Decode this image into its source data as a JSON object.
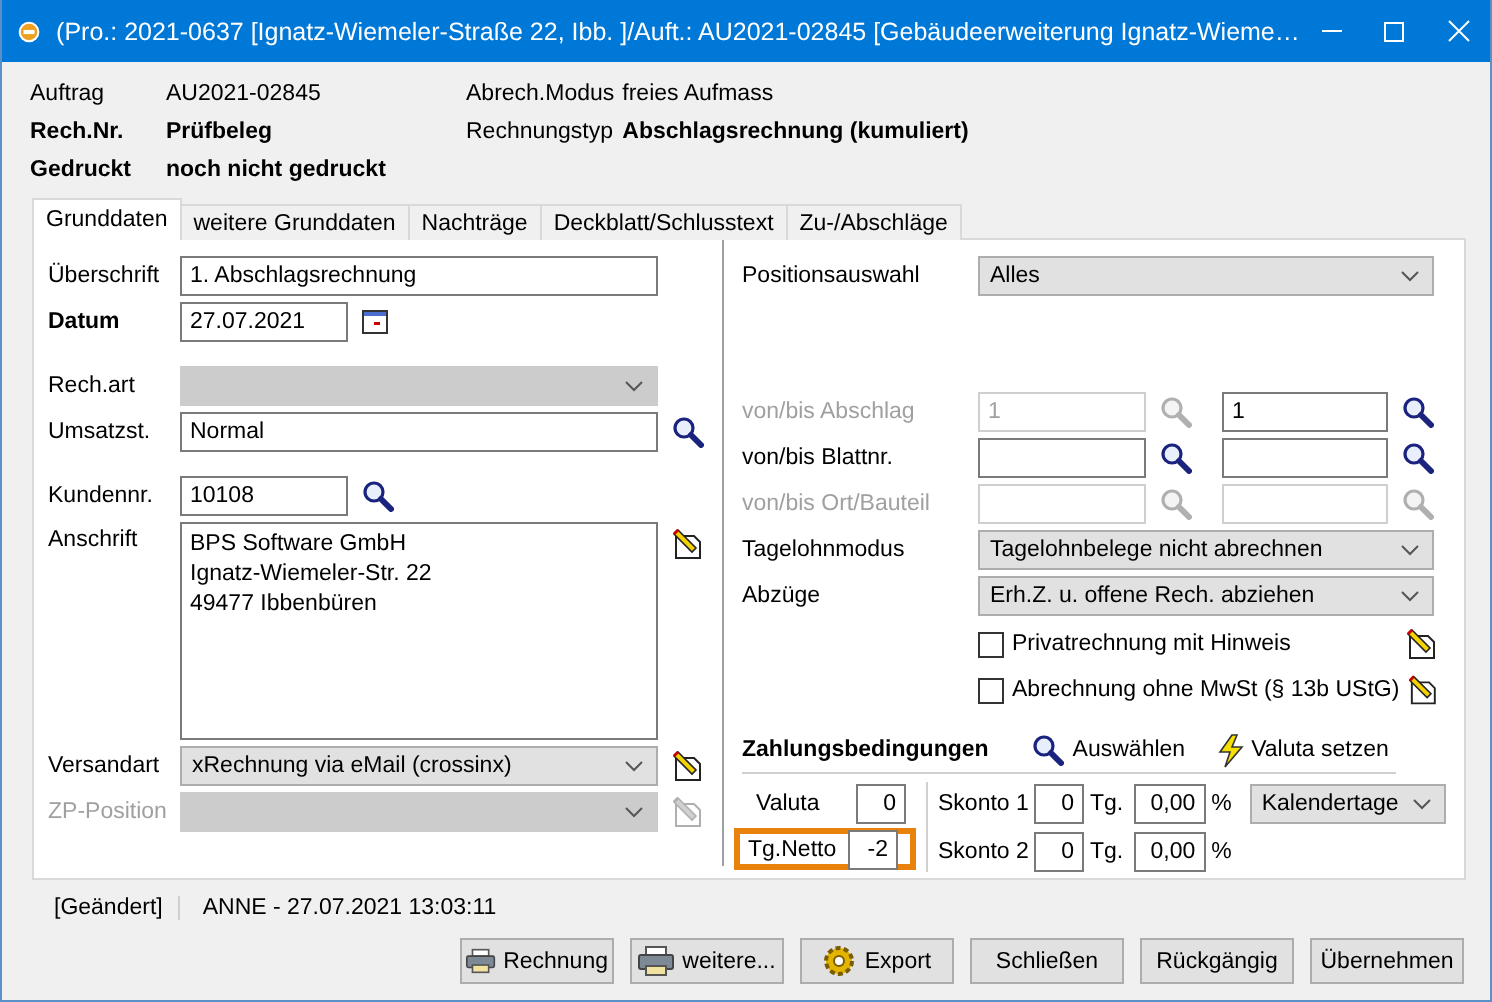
{
  "window": {
    "title": "(Pro.: 2021-0637 [Ignatz-Wiemeler-Straße 22, Ibb. ]/Auft.: AU2021-02845 [Gebäudeerweiterung Ignatz-Wieme…"
  },
  "header": [
    [
      {
        "text": "Auftrag",
        "bold": false
      },
      {
        "text": "AU2021-02845",
        "bold": false
      },
      {
        "text": "Abrech.Modus",
        "bold": false
      },
      {
        "text": "freies Aufmass",
        "bold": false
      }
    ],
    [
      {
        "text": "Rech.Nr.",
        "bold": true
      },
      {
        "text": "Prüfbeleg",
        "bold": true
      },
      {
        "text": "Rechnungstyp",
        "bold": false
      },
      {
        "text": "Abschlagsrechnung (kumuliert)",
        "bold": true
      }
    ],
    [
      {
        "text": "Gedruckt",
        "bold": true
      },
      {
        "text": "noch nicht gedruckt",
        "bold": true
      }
    ]
  ],
  "tabs": [
    {
      "label": "Grunddaten",
      "selected": true
    },
    {
      "label": "weitere Grunddaten",
      "selected": false
    },
    {
      "label": "Nachträge",
      "selected": false
    },
    {
      "label": "Deckblatt/Schlusstext",
      "selected": false
    },
    {
      "label": "Zu-/Abschläge",
      "selected": false
    }
  ],
  "left": {
    "groups": [
      [
        {
          "kind": "text",
          "label": "Überschrift",
          "label_bold": false,
          "label_disabled": false,
          "disabled": false,
          "value": "1. Abschlagsrechnung"
        },
        {
          "kind": "short_text",
          "label": "Datum",
          "label_bold": true,
          "label_disabled": false,
          "disabled": false,
          "value": "27.07.2021",
          "tool": {
            "kind": "calendar"
          }
        }
      ],
      [
        {
          "kind": "select",
          "label": "Rech.art",
          "label_bold": false,
          "label_disabled": false,
          "disabled": true
        },
        {
          "kind": "text",
          "label": "Umsatzst.",
          "label_bold": false,
          "label_disabled": false,
          "disabled": false,
          "value": "Normal",
          "tool": {
            "kind": "search"
          }
        }
      ],
      [
        {
          "kind": "short_text",
          "label": "Kundennr.",
          "label_bold": false,
          "label_disabled": false,
          "disabled": false,
          "value": "10108",
          "tool": {
            "kind": "search"
          }
        },
        {
          "kind": "textarea",
          "label": "Anschrift",
          "label_bold": false,
          "label_disabled": false,
          "disabled": false,
          "value": "BPS Software GmbH\nIgnatz-Wiemeler-Str. 22\n49477 Ibbenbüren",
          "tool": {
            "kind": "edit"
          }
        },
        {
          "kind": "select",
          "label": "Versandart",
          "label_bold": false,
          "label_disabled": false,
          "disabled": false,
          "value": "xRechnung via eMail (crossinx)",
          "tool": {
            "kind": "edit"
          }
        },
        {
          "kind": "select",
          "label": "ZP-Position",
          "label_bold": false,
          "label_disabled": true,
          "disabled": true,
          "tool": {
            "kind": "edit"
          }
        }
      ]
    ]
  },
  "right": {
    "position": {
      "label": "Positionsauswahl",
      "value": "Alles"
    },
    "ranges": [
      {
        "label": "von/bis Abschlag",
        "disabled": true,
        "from": {
          "value": "1",
          "disabled": true
        },
        "to": {
          "value": "1",
          "disabled": false
        }
      },
      {
        "label": "von/bis Blattnr.",
        "disabled": false,
        "from": {
          "disabled": false
        },
        "to": {
          "disabled": false
        }
      },
      {
        "label": "von/bis Ort/Bauteil",
        "disabled": true,
        "from": {
          "disabled": true
        },
        "to": {
          "disabled": true
        }
      }
    ],
    "selects": [
      {
        "label": "Tagelohnmodus",
        "value": "Tagelohnbelege nicht abrechnen"
      },
      {
        "label": "Abzüge",
        "value": "Erh.Z. u. offene Rech. abziehen"
      }
    ],
    "checkboxes": [
      {
        "label": "Privatrechnung mit Hinweis",
        "checked": false
      },
      {
        "label": "Abrechnung ohne MwSt (§ 13b UStG)",
        "checked": false
      }
    ]
  },
  "payment": {
    "title": "Zahlungsbedingungen",
    "links": [
      {
        "label": "Auswählen",
        "kind": "search"
      },
      {
        "label": "Valuta setzen",
        "kind": "lightning"
      }
    ],
    "terms": [
      {
        "label": "Valuta",
        "value": "0",
        "highlighted": false
      },
      {
        "label": "Tg.Netto",
        "value": "-2",
        "highlighted": true
      }
    ],
    "skonto": [
      {
        "label": "Skonto 1",
        "days": "0",
        "days_unit": "Tg.",
        "percent": "0,00",
        "percent_unit": "%"
      },
      {
        "label": "Skonto 2",
        "days": "0",
        "days_unit": "Tg.",
        "percent": "0,00",
        "percent_unit": "%"
      }
    ],
    "day_mode": "Kalendertage"
  },
  "status": {
    "state": "[Geändert]",
    "info": "ANNE - 27.07.2021 13:03:11"
  },
  "buttons": [
    {
      "label": "Rechnung",
      "kind": "printer"
    },
    {
      "label": "weitere...",
      "kind": "printer"
    },
    {
      "label": "Export",
      "kind": "gear"
    },
    {
      "label": "Schließen",
      "kind": "plain"
    },
    {
      "label": "Rückgängig",
      "kind": "plain"
    },
    {
      "label": "Übernehmen",
      "kind": "plain"
    }
  ]
}
